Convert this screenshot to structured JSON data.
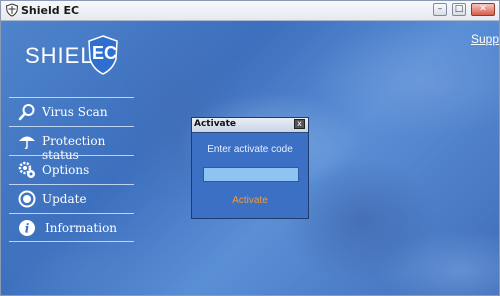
{
  "window": {
    "title": "Shield EC",
    "title_icon": "shield-icon"
  },
  "header": {
    "logo_text": "SHIELD",
    "logo_badge_text": "EC",
    "support_link": "Supp"
  },
  "sidebar": {
    "items": [
      {
        "label": "Virus Scan",
        "icon": "search-icon"
      },
      {
        "label": "Protection status",
        "icon": "umbrella-icon"
      },
      {
        "label": "Options",
        "icon": "gear-icon"
      },
      {
        "label": "Update",
        "icon": "update-icon"
      },
      {
        "label": "Information",
        "icon": "info-icon"
      }
    ]
  },
  "dialog": {
    "title": "Activate",
    "close_glyph": "x",
    "prompt": "Enter activate code",
    "input_value": "",
    "action_label": "Activate"
  },
  "colors": {
    "action": "#f19a3e",
    "input_bg": "#8ec3f2",
    "badge": "#2f6fcf"
  }
}
